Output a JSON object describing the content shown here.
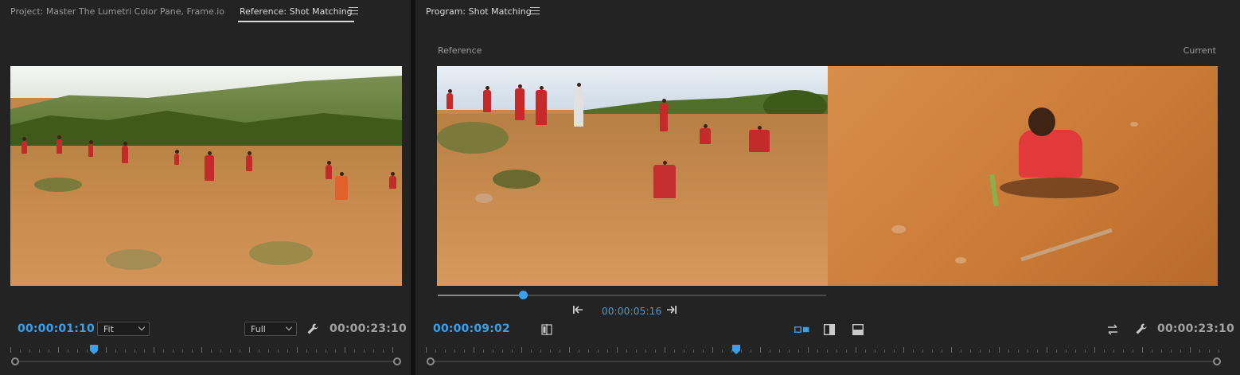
{
  "left_panel": {
    "tabs": [
      {
        "label": "Project: Master The Lumetri Color Pane, Frame.io",
        "active": false
      },
      {
        "label": "Reference: Shot Matching",
        "active": true
      }
    ],
    "current_timecode": "00:00:01:10",
    "duration_timecode": "00:00:23:10",
    "zoom_select": {
      "value": "Fit"
    },
    "resolution_select": {
      "value": "Full"
    },
    "icons": {
      "settings": "wrench-icon",
      "panel_menu": "hamburger-menu-icon"
    }
  },
  "right_panel": {
    "tab": {
      "label": "Program: Shot Matching",
      "active": true
    },
    "reference_label": "Reference",
    "current_label": "Current",
    "reference_timecode": "00:00:05:16",
    "current_timecode": "00:00:09:02",
    "duration_timecode": "00:00:23:10",
    "reference_slider": {
      "position": 0.22
    },
    "icons": {
      "step_back": "step-to-start-icon",
      "step_forward": "step-to-end-icon",
      "side_by_side": "side-by-side-icon",
      "vertical_split": "vertical-split-icon",
      "horizontal_split": "horizontal-split-icon",
      "face_detection": "face-detection-icon",
      "swap_sides": "swap-sides-icon",
      "settings": "wrench-icon",
      "panel_menu": "hamburger-menu-icon"
    }
  },
  "colors": {
    "accent": "#3aa0e8",
    "panel_bg": "#232323",
    "text": "#a8a8a8"
  }
}
